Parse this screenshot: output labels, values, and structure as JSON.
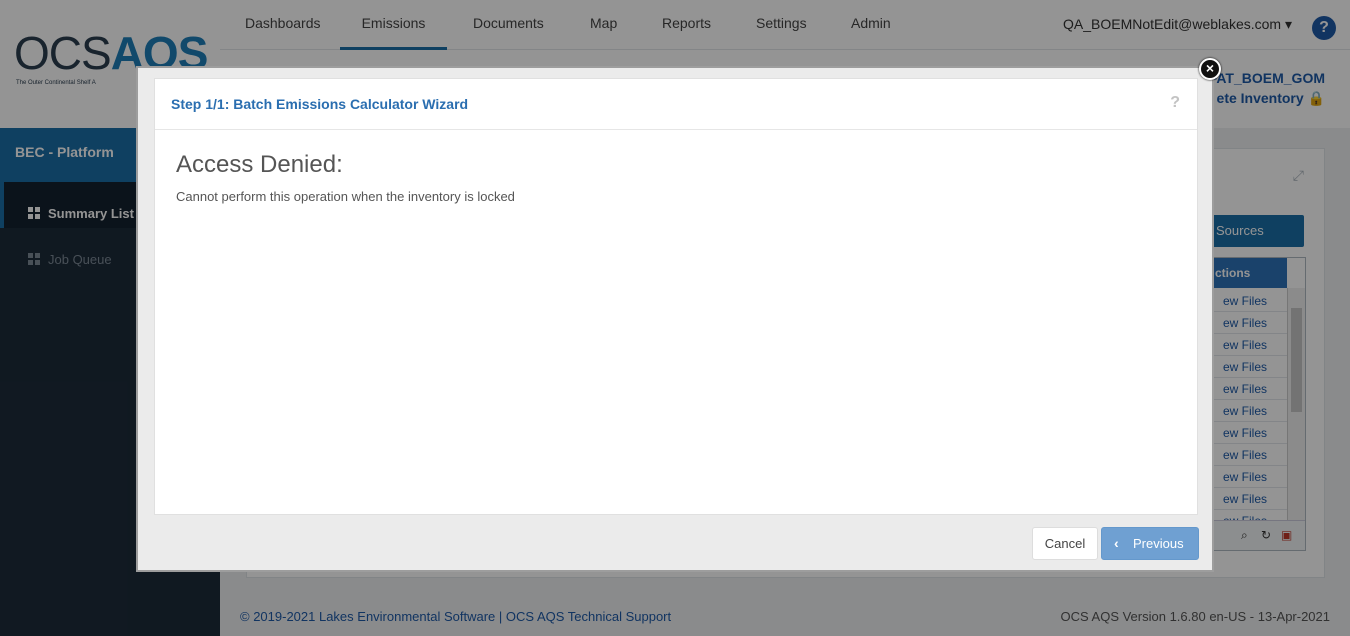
{
  "brand": {
    "logo_ocs": "OCS",
    "logo_aqs": "AQS",
    "tagline": "The Outer Continental Shelf A"
  },
  "nav": {
    "items": [
      "Dashboards",
      "Emissions",
      "Documents",
      "Map",
      "Reports",
      "Settings",
      "Admin"
    ],
    "active": "Emissions",
    "user": "QA_BOEMNotEdit@weblakes.com ▾",
    "help": "?"
  },
  "inventory": {
    "line1": "FAT_BOEM_GOM",
    "line2": "ete Inventory 🔒"
  },
  "sidebar": {
    "header": "BEC - Platform",
    "items": [
      {
        "label": "Summary List",
        "active": true
      },
      {
        "label": "Job Queue",
        "active": false
      }
    ]
  },
  "panel": {
    "button_label": "orm Sources",
    "grid_header": "ctions",
    "row_label": "ew Files",
    "rows": 11
  },
  "footer": {
    "left": "© 2019-2021 Lakes Environmental Software | OCS AQS Technical Support",
    "right": "OCS AQS Version 1.6.80 en-US - 13-Apr-2021"
  },
  "modal": {
    "title": "Step 1/1: Batch Emissions Calculator Wizard",
    "help": "?",
    "heading": "Access Denied:",
    "message": "Cannot perform this operation when the inventory is locked",
    "cancel_label": "Cancel",
    "previous_label": "Previous",
    "close_glyph": "×"
  },
  "colors": {
    "accent": "#1b6fa8",
    "link": "#1e5aa8",
    "primary_disabled": "#6fa0d2"
  }
}
